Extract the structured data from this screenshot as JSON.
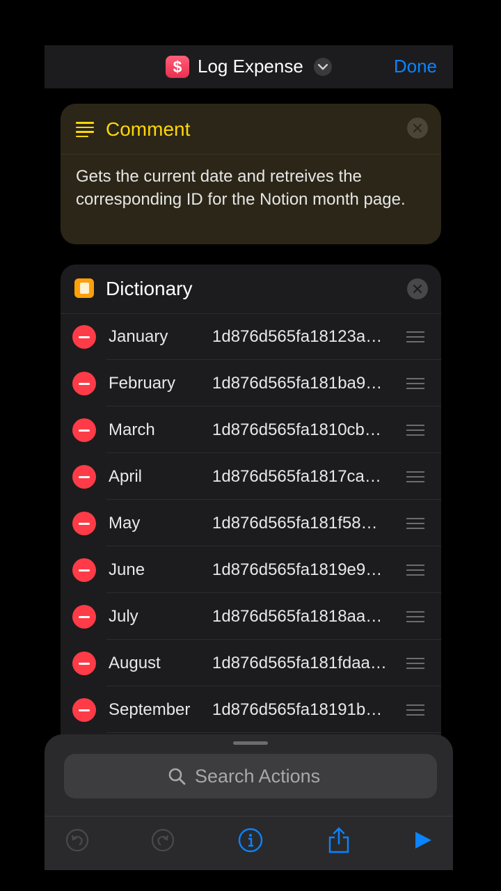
{
  "header": {
    "title": "Log Expense",
    "app_icon_glyph": "$",
    "done_label": "Done"
  },
  "comment": {
    "title": "Comment",
    "body": "Gets the current date and retreives the corresponding ID for the Notion month page."
  },
  "dictionary": {
    "title": "Dictionary",
    "items": [
      {
        "key": "January",
        "value": "1d876d565fa18123a…"
      },
      {
        "key": "February",
        "value": "1d876d565fa181ba9…"
      },
      {
        "key": "March",
        "value": "1d876d565fa1810cb…"
      },
      {
        "key": "April",
        "value": "1d876d565fa1817ca…"
      },
      {
        "key": "May",
        "value": "1d876d565fa181f58…"
      },
      {
        "key": "June",
        "value": "1d876d565fa1819e9…"
      },
      {
        "key": "July",
        "value": "1d876d565fa1818aa…"
      },
      {
        "key": "August",
        "value": "1d876d565fa181fdaa…"
      },
      {
        "key": "September",
        "value": "1d876d565fa18191b…"
      }
    ]
  },
  "search": {
    "placeholder": "Search Actions"
  },
  "toolbar": {
    "icons": [
      "undo-icon",
      "redo-icon",
      "info-icon",
      "share-icon",
      "play-icon"
    ]
  },
  "colors": {
    "accent": "#0a84ff",
    "comment_yellow": "#ffd60a",
    "delete_red": "#ff3b47",
    "dictionary_orange": "#ff9f0a"
  }
}
